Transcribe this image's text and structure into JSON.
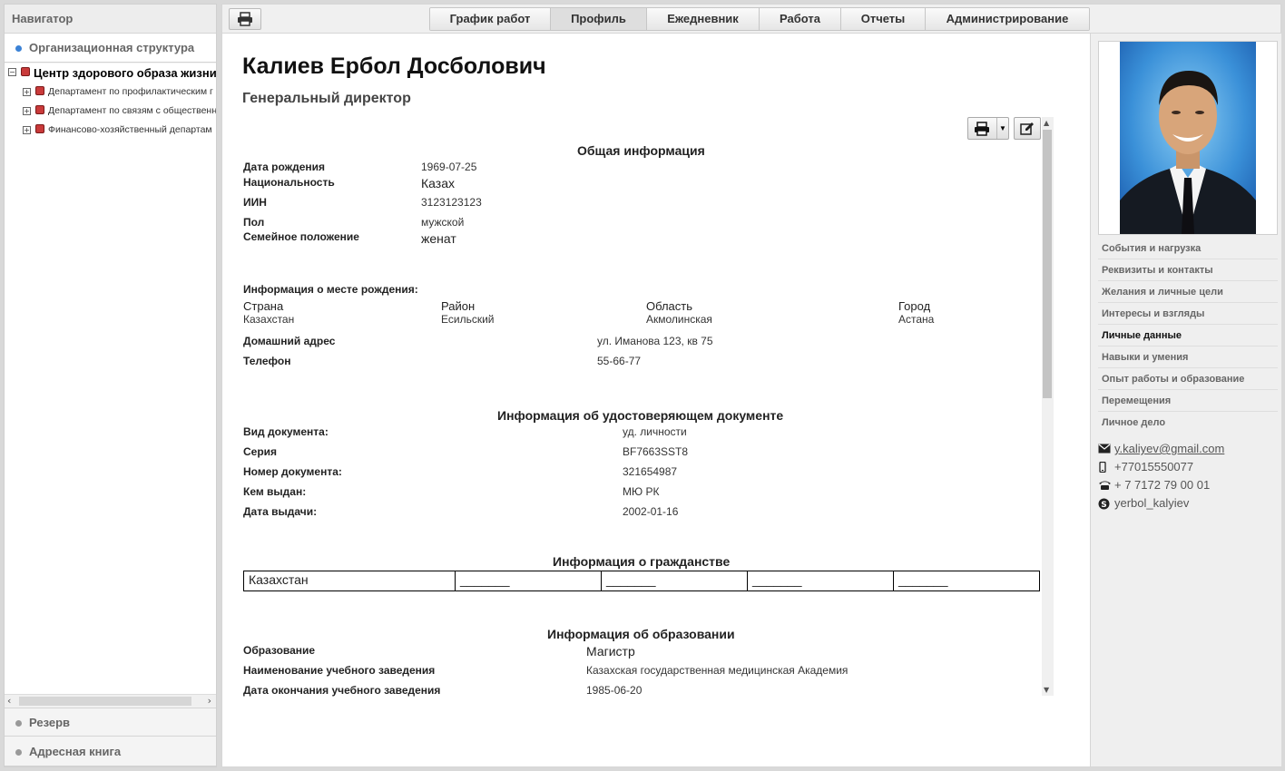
{
  "navigator": {
    "title": "Навигатор",
    "org_structure": "Организационная структура",
    "tree": {
      "root": "Центр здорового образа жизни",
      "children": [
        "Департамент по профилактическим г",
        "Департамент по связям с общественн",
        "Финансово-хозяйственный департам"
      ]
    },
    "reserve": "Резерв",
    "address_book": "Адресная книга"
  },
  "tabs": [
    {
      "label": "График работ",
      "active": false
    },
    {
      "label": "Профиль",
      "active": true
    },
    {
      "label": "Ежедневник",
      "active": false
    },
    {
      "label": "Работа",
      "active": false
    },
    {
      "label": "Отчеты",
      "active": false
    },
    {
      "label": "Администрирование",
      "active": false
    }
  ],
  "person": {
    "name": "Калиев Ербол Досболович",
    "position": "Генеральный директор"
  },
  "general": {
    "title": "Общая информация",
    "birth_date_label": "Дата рождения",
    "birth_date": "1969-07-25",
    "nationality_label": "Национальность",
    "nationality": "Казах",
    "iin_label": "ИИН",
    "iin": "3123123123",
    "gender_label": "Пол",
    "gender": "мужской",
    "marital_label": "Семейное положение",
    "marital": "женат"
  },
  "birthplace": {
    "title": "Информация о месте рождения:",
    "country_label": "Страна",
    "country": "Казахстан",
    "district_label": "Район",
    "district": "Есильский",
    "region_label": "Область",
    "region": "Акмолинская",
    "city_label": "Город",
    "city": "Астана",
    "address_label": "Домашний адрес",
    "address": "ул. Иманова 123, кв 75",
    "phone_label": "Телефон",
    "phone": "55-66-77"
  },
  "id_document": {
    "title": "Информация об удостоверяющем документе",
    "type_label": "Вид документа:",
    "type": "уд. личности",
    "series_label": "Серия",
    "series": "BF7663SST8",
    "number_label": "Номер документа:",
    "number": "321654987",
    "issued_by_label": "Кем выдан:",
    "issued_by": "МЮ РК",
    "issue_date_label": "Дата выдачи:",
    "issue_date": "2002-01-16"
  },
  "citizenship": {
    "title": "Информация о гражданстве",
    "cells": [
      "Казахстан",
      "_______",
      "_______",
      "_______",
      "_______"
    ]
  },
  "education": {
    "title": "Информация об образовании",
    "level_label": "Образование",
    "level": "Магистр",
    "institution_label": "Наименование учебного заведения",
    "institution": "Казахская государственная медицинская Академия",
    "graduation_label": "Дата окончания учебного заведения",
    "graduation": "1985-06-20"
  },
  "right_menu": [
    {
      "label": "События и нагрузка",
      "active": false
    },
    {
      "label": "Реквизиты и контакты",
      "active": false
    },
    {
      "label": "Желания и личные цели",
      "active": false
    },
    {
      "label": "Интересы и взгляды",
      "active": false
    },
    {
      "label": "Личные данные",
      "active": true
    },
    {
      "label": "Навыки и умения",
      "active": false
    },
    {
      "label": "Опыт работы и образование",
      "active": false
    },
    {
      "label": "Перемещения",
      "active": false
    },
    {
      "label": "Личное дело",
      "active": false
    }
  ],
  "contacts": {
    "email": "y.kaliyev@gmail.com",
    "mobile": "+77015550077",
    "phone": "+ 7 7172 79 00 01",
    "skype": "yerbol_kalyiev"
  },
  "colors": {
    "tree_node": "#c93a3a",
    "active_dot": "#3b82d6",
    "photo_bg": "#2f7fd0"
  }
}
